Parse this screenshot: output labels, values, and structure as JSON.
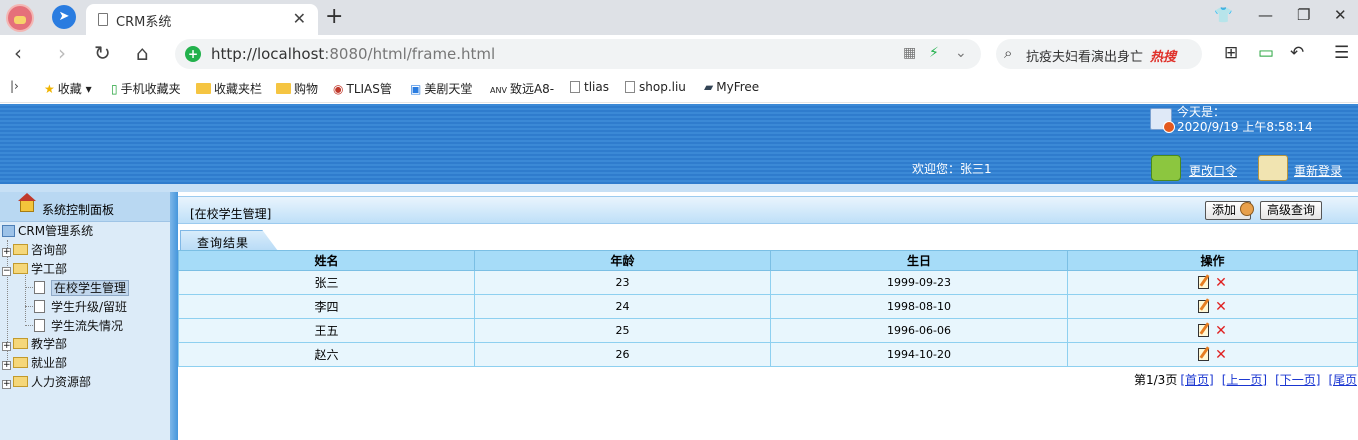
{
  "browser": {
    "tab_title": "CRM系统",
    "url_host": "http://localhost",
    "url_rest": ":8080/html/frame.html",
    "search_text": "抗疫夫妇看演出身亡",
    "search_hot": "热搜",
    "bookmarks": [
      "收藏",
      "手机收藏夹",
      "收藏夹栏",
      "购物",
      "TLIAS管",
      "美剧天堂",
      "致远A8-",
      "tlias",
      "shop.liu",
      "MyFree"
    ]
  },
  "header": {
    "today_label": "今天是：",
    "datetime": "2020/9/19 上午8:58:14",
    "welcome": "欢迎您：张三1",
    "change_password": "更改口令",
    "relogin": "重新登录"
  },
  "sidebar": {
    "control_panel": "系统控制面板",
    "root": "CRM管理系统",
    "nodes": {
      "consult": "咨询部",
      "student_affairs": "学工部",
      "in_school": "在校学生管理",
      "upgrade": "学生升级/留班",
      "loss": "学生流失情况",
      "teaching": "教学部",
      "employment": "就业部",
      "hr": "人力资源部"
    }
  },
  "main": {
    "breadcrumb": "[在校学生管理]",
    "add_button": "添加",
    "advanced_search_button": "高级查询",
    "result_tab": "查询结果",
    "columns": [
      "姓名",
      "年龄",
      "生日",
      "操作"
    ],
    "rows": [
      {
        "name": "张三",
        "age": "23",
        "birthday": "1999-09-23"
      },
      {
        "name": "李四",
        "age": "24",
        "birthday": "1998-08-10"
      },
      {
        "name": "王五",
        "age": "25",
        "birthday": "1996-06-06"
      },
      {
        "name": "赵六",
        "age": "26",
        "birthday": "1994-10-20"
      }
    ],
    "pager": {
      "status": "第1/3页",
      "first": "[首页]",
      "prev": "[上一页]",
      "next": "[下一页]",
      "last": "[尾页]"
    }
  }
}
